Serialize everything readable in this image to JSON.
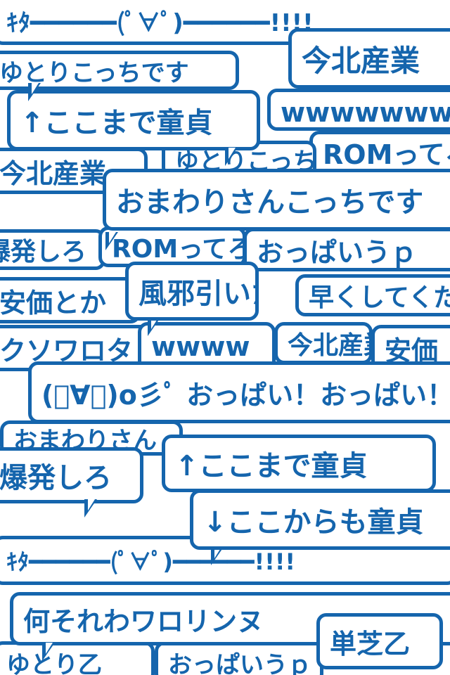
{
  "accent_color": "#1565ad",
  "bubbles": [
    {
      "text": "ｷﾀ━━━━━━(ﾟ∀ﾟ)━━━━━━!!!!"
    },
    {
      "text": "今北産業"
    },
    {
      "text": "↑ここまで童貞"
    },
    {
      "text": "wwwwwwwwww安価は絶対"
    },
    {
      "text": "ROMってろ"
    },
    {
      "text": "今北産業"
    },
    {
      "text": "ゆとりこっちです"
    },
    {
      "text": "おまわりさんこっちです"
    },
    {
      "text": "爆発しろ"
    },
    {
      "text": "ROMってろ"
    },
    {
      "text": "おっぱいうｐ"
    },
    {
      "text": "安価とか"
    },
    {
      "text": "風邪引いた"
    },
    {
      "text": "早くしてください"
    },
    {
      "text": "クソワロタ"
    },
    {
      "text": "wwww"
    },
    {
      "text": "今北産業"
    },
    {
      "text": "安価"
    },
    {
      "text": "(ﾟ∀ﾟ)o彡ﾟ おっぱい！おっぱい！"
    },
    {
      "text": "おまわりさん"
    },
    {
      "text": "↑ここまで童貞"
    },
    {
      "text": "爆発しろ"
    },
    {
      "text": "↓ここからも童貞"
    },
    {
      "text": "ｷﾀ━━━━━━(ﾟ∀ﾟ)━━━━━━!!!!"
    },
    {
      "text": "何それわワロリンヌ"
    },
    {
      "text": "単芝乙"
    },
    {
      "text": "ゆとり乙"
    },
    {
      "text": "おっぱいうｐ"
    }
  ]
}
